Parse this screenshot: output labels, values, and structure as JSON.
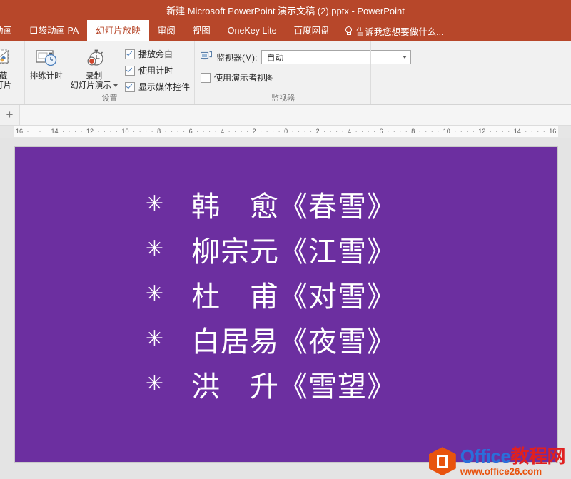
{
  "window": {
    "title": "新建 Microsoft PowerPoint 演示文稿 (2).pptx - PowerPoint",
    "accent_color": "#b7472a",
    "ribbon_bg": "#f1f1f1"
  },
  "tabs": [
    {
      "label": "动画",
      "active": false
    },
    {
      "label": "口袋动画 PA",
      "active": false
    },
    {
      "label": "幻灯片放映",
      "active": true
    },
    {
      "label": "审阅",
      "active": false
    },
    {
      "label": "视图",
      "active": false
    },
    {
      "label": "OneKey Lite",
      "active": false
    },
    {
      "label": "百度网盘",
      "active": false
    }
  ],
  "tell_me": {
    "icon": "lightbulb-icon",
    "placeholder": "告诉我您想要做什么..."
  },
  "ribbon": {
    "groups": [
      {
        "name": "hide-slide-group",
        "label": "",
        "buttons": [
          {
            "name": "hide-slide",
            "line1": "隐藏",
            "line2": "幻灯片",
            "icon": "hide-slide-icon"
          }
        ]
      },
      {
        "name": "setup-group",
        "label": "设置",
        "buttons": [
          {
            "name": "rehearse-timings",
            "line1": "排练计时",
            "line2": "",
            "icon": "rehearse-timings-icon"
          },
          {
            "name": "record-slide-show",
            "line1": "录制",
            "line2": "幻灯片演示",
            "icon": "record-slideshow-icon",
            "has_dropdown": true
          }
        ],
        "checkboxes": [
          {
            "name": "play-narrations",
            "label": "播放旁白",
            "checked": true
          },
          {
            "name": "use-timings",
            "label": "使用计时",
            "checked": true
          },
          {
            "name": "show-media-controls",
            "label": "显示媒体控件",
            "checked": true
          }
        ]
      },
      {
        "name": "monitor-group",
        "label": "监视器",
        "monitor": {
          "icon": "monitor-icon",
          "label": "监视器(M):",
          "combo_value": "自动",
          "combo_caret": "chevron-down-icon"
        },
        "presenter_view": {
          "name": "use-presenter-view",
          "label": "使用演示者视图",
          "checked": false
        }
      }
    ]
  },
  "slide_panel": {
    "add_slide_label": "+"
  },
  "ruler": {
    "ticks": [
      "16",
      "14",
      "12",
      "10",
      "8",
      "6",
      "4",
      "2",
      "0",
      "2",
      "4",
      "6",
      "8",
      "10",
      "12",
      "14",
      "16"
    ]
  },
  "slide": {
    "background_color": "#6c2fa0",
    "text_color": "#ffffff",
    "bullet_glyph": "✳",
    "lines": [
      {
        "author": "韩　愈",
        "title": "《春雪》"
      },
      {
        "author": "柳宗元",
        "title": "《江雪》"
      },
      {
        "author": "杜　甫",
        "title": "《对雪》"
      },
      {
        "author": "白居易",
        "title": "《夜雪》"
      },
      {
        "author": "洪　升",
        "title": "《雪望》"
      }
    ],
    "lines_full": [
      "韩　愈《春雪》",
      "柳宗元《江雪》",
      "杜　甫《对雪》",
      "白居易《夜雪》",
      "洪　升《雪望》"
    ]
  },
  "watermark": {
    "brand_en": "Office",
    "brand_cn": "教程网",
    "url": "www.office26.com",
    "logo": "office-logo-icon",
    "color_blue": "#2a6fdb",
    "color_red": "#e02020",
    "color_orange": "#e8530e"
  }
}
